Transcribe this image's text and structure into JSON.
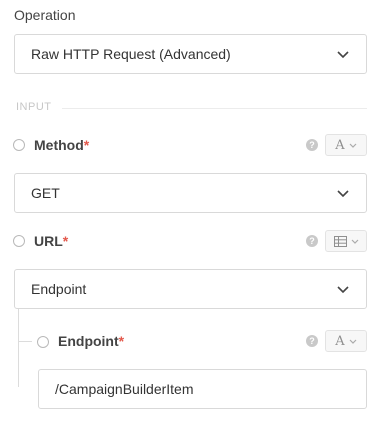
{
  "operation": {
    "label": "Operation",
    "value": "Raw HTTP Request (Advanced)"
  },
  "section": {
    "title": "INPUT"
  },
  "method": {
    "label": "Method",
    "required_mark": "*",
    "help_icon": "question-circle-icon",
    "type_icon": "text-type-icon",
    "type_glyph": "A",
    "value": "GET"
  },
  "url": {
    "label": "URL",
    "required_mark": "*",
    "help_icon": "question-circle-icon",
    "type_icon": "table-type-icon",
    "value": "Endpoint"
  },
  "endpoint": {
    "label": "Endpoint",
    "required_mark": "*",
    "help_icon": "question-circle-icon",
    "type_icon": "text-type-icon",
    "type_glyph": "A",
    "value": "/CampaignBuilderItem"
  },
  "colors": {
    "required": "#e3584b",
    "border": "#d9d9d9",
    "muted": "#c7c7c7"
  }
}
